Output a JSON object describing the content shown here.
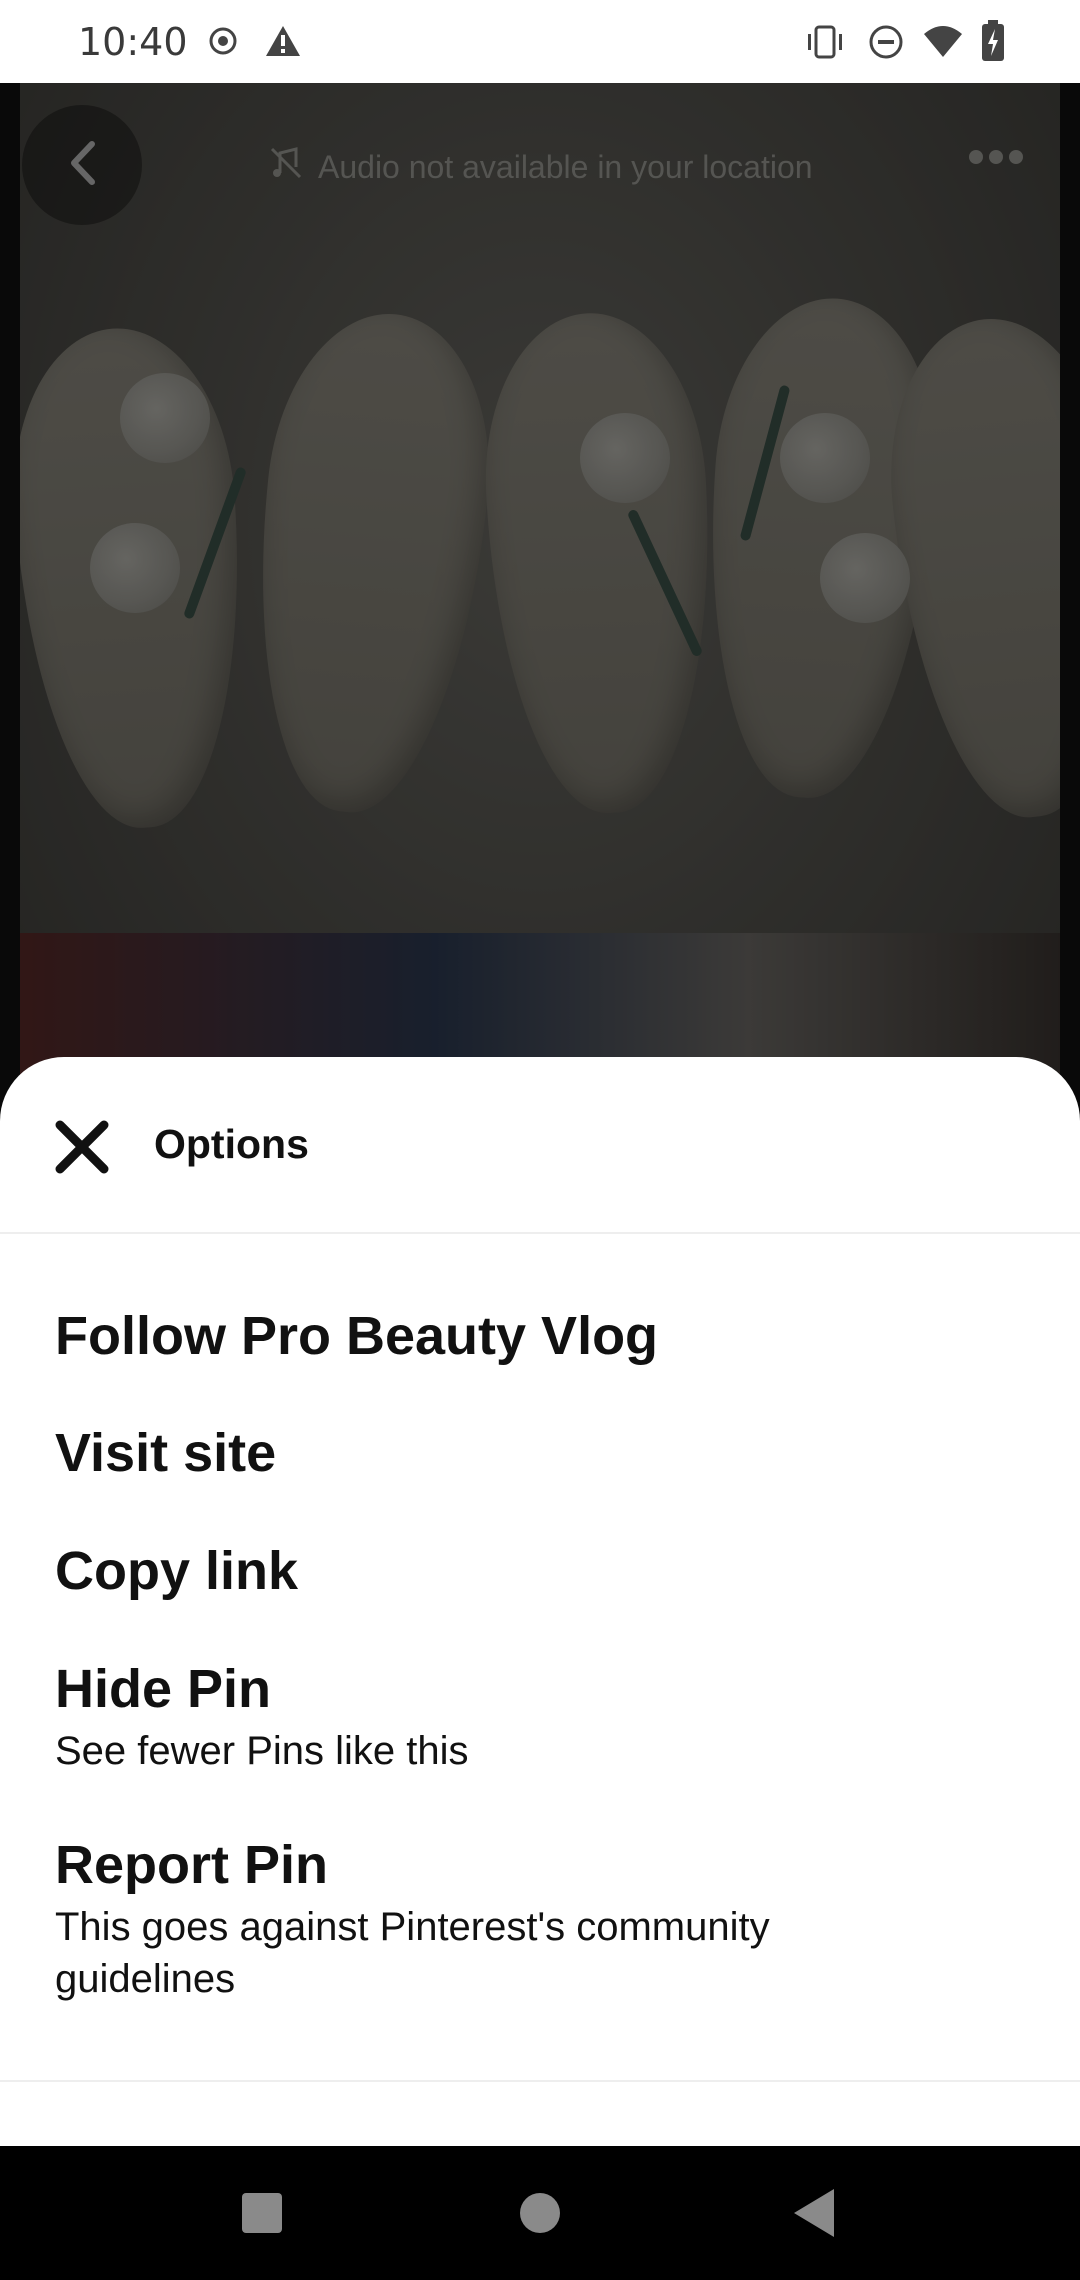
{
  "status_bar": {
    "time": "10:40",
    "left_icons": [
      "record-icon",
      "warning-icon"
    ],
    "right_icons": [
      "vibrate-icon",
      "do-not-disturb-icon",
      "wifi-icon",
      "battery-charging-icon"
    ]
  },
  "pin_header": {
    "back_icon": "chevron-left-icon",
    "audio_notice": "Audio not available in your location",
    "more_icon": "more-horizontal-icon"
  },
  "sheet": {
    "title": "Options",
    "close_icon": "close-icon",
    "options": [
      {
        "label": "Follow Pro Beauty Vlog"
      },
      {
        "label": "Visit site"
      },
      {
        "label": "Copy link"
      },
      {
        "label": "Hide Pin",
        "sublabel": "See fewer Pins like this"
      },
      {
        "label": "Report Pin",
        "sublabel": "This goes against Pinterest's community guidelines"
      }
    ]
  },
  "nav_bar": {
    "buttons": [
      "recents-square-icon",
      "home-circle-icon",
      "back-triangle-icon"
    ]
  }
}
